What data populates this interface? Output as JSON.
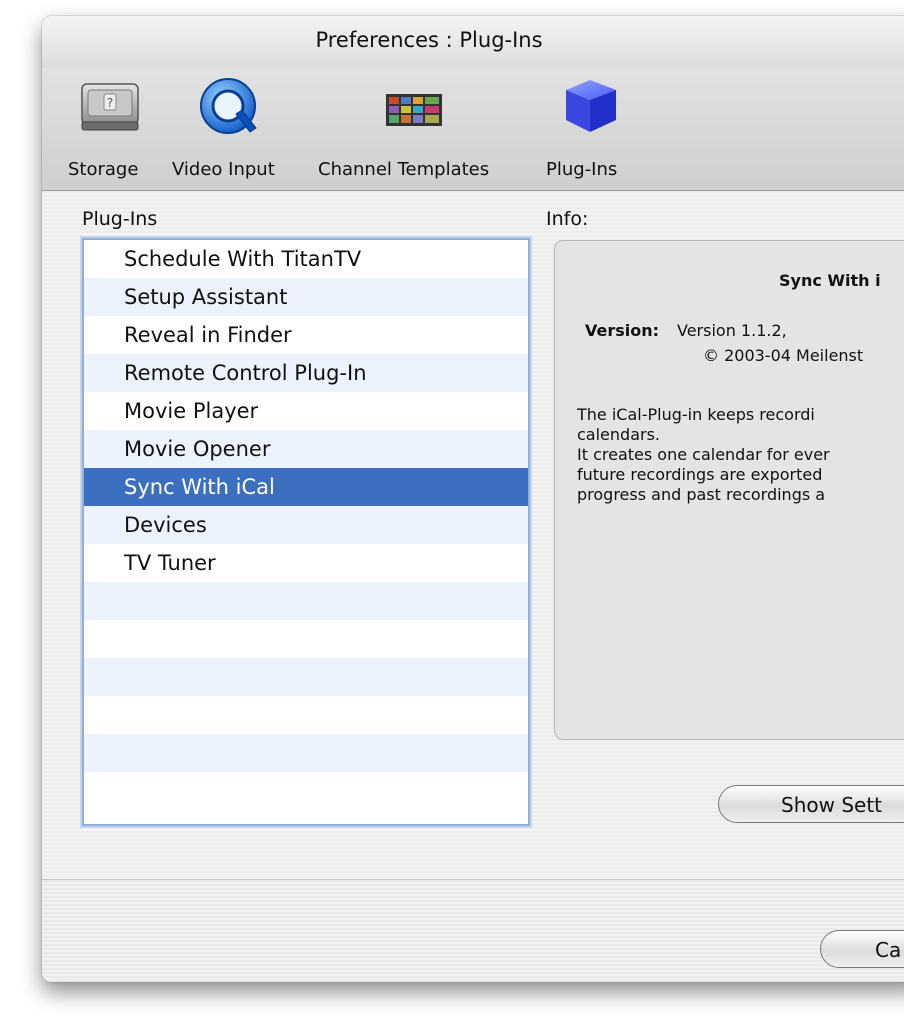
{
  "window": {
    "title": "Preferences : Plug-Ins"
  },
  "toolbar": {
    "items": [
      {
        "label": "Storage",
        "icon": "hard-drive-icon"
      },
      {
        "label": "Video Input",
        "icon": "quicktime-icon"
      },
      {
        "label": "Channel Templates",
        "icon": "channel-grid-icon"
      },
      {
        "label": "Plug-Ins",
        "icon": "blue-cube-icon"
      }
    ]
  },
  "plugins": {
    "header": "Plug-Ins",
    "items": [
      "Schedule With TitanTV",
      "Setup Assistant",
      "Reveal in Finder",
      "Remote Control Plug-In",
      "Movie Player",
      "Movie Opener",
      "Sync With iCal",
      "Devices",
      "TV Tuner"
    ],
    "selected": "Sync With iCal"
  },
  "info": {
    "header": "Info:",
    "title": "Sync With i",
    "version_label": "Version:",
    "version_value": "Version 1.1.2,",
    "copyright": "© 2003-04 Meilenst",
    "description": [
      "The iCal-Plug-in keeps recordi",
      "calendars.",
      "It creates one calendar for ever",
      "future recordings are exported",
      "progress and past recordings a"
    ]
  },
  "buttons": {
    "show_settings": "Show Sett",
    "cancel": "Ca"
  },
  "colors": {
    "selection": "#3d6fc0",
    "alt_row": "#edf3fe",
    "focus_ring": "#8fb0d6"
  }
}
